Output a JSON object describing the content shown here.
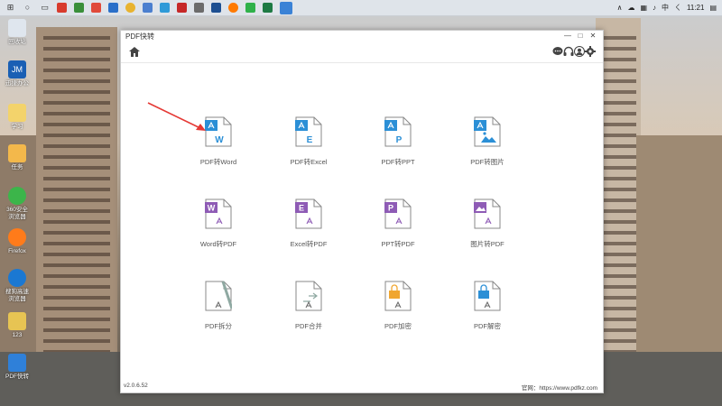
{
  "taskbar": {
    "clock": "11:21",
    "ime": "中",
    "ime_sub": "ㄑ"
  },
  "desktop": {
    "icons": [
      {
        "label": "回收站"
      },
      {
        "label": "迅捷办公"
      },
      {
        "label": "学习"
      },
      {
        "label": "任务"
      },
      {
        "label": "360安全浏览器"
      },
      {
        "label": "Firefox"
      },
      {
        "label": "搜狗高速浏览器"
      },
      {
        "label": "123"
      },
      {
        "label": "PDF快转"
      }
    ]
  },
  "window": {
    "title": "PDF快转",
    "controls": {
      "min": "—",
      "max": "□",
      "close": "✕"
    },
    "version": "v2.0.6.52",
    "website": "官网：https://www.pdfkz.com"
  },
  "tiles": [
    {
      "label": "PDF转Word",
      "badge": "W",
      "color": "#2b8fd6"
    },
    {
      "label": "PDF转Excel",
      "badge": "E",
      "color": "#2b8fd6"
    },
    {
      "label": "PDF转PPT",
      "badge": "P",
      "color": "#2b8fd6"
    },
    {
      "label": "PDF转图片",
      "badge": "",
      "color": "#2b8fd6"
    },
    {
      "label": "Word转PDF",
      "badge": "W",
      "color": "#8e5bb5"
    },
    {
      "label": "Excel转PDF",
      "badge": "E",
      "color": "#8e5bb5"
    },
    {
      "label": "PPT转PDF",
      "badge": "P",
      "color": "#8e5bb5"
    },
    {
      "label": "图片转PDF",
      "badge": "",
      "color": "#8e5bb5"
    },
    {
      "label": "PDF拆分",
      "badge": "",
      "color": "#8fa9a2"
    },
    {
      "label": "PDF合并",
      "badge": "",
      "color": "#8fa9a2"
    },
    {
      "label": "PDF加密",
      "badge": "",
      "color": "#f0a630"
    },
    {
      "label": "PDF解密",
      "badge": "",
      "color": "#2b8fd6"
    }
  ]
}
